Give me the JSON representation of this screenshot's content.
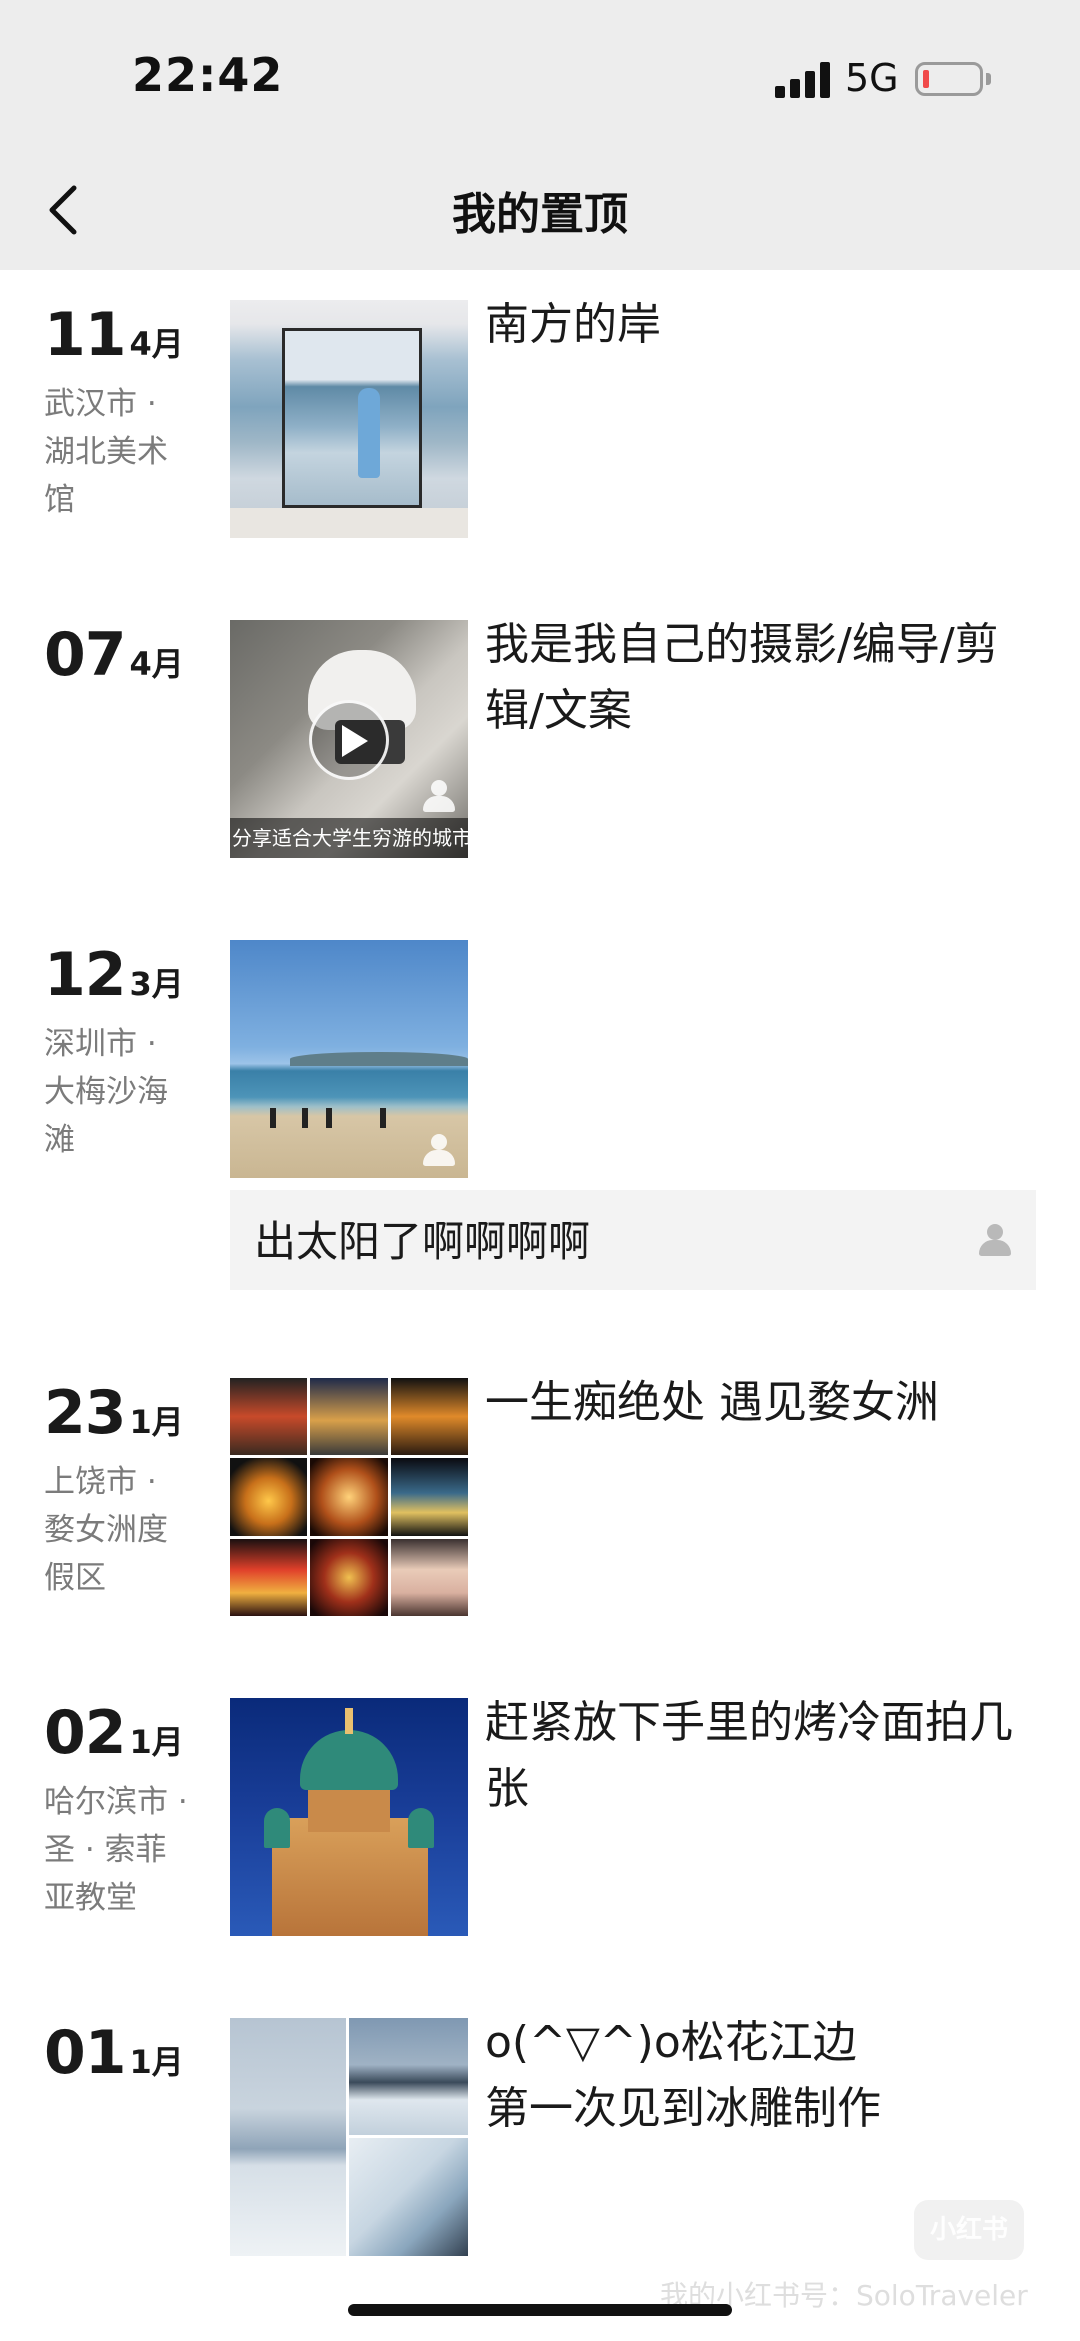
{
  "status_bar": {
    "time": "22:42",
    "network": "5G",
    "icons": [
      "signal-icon",
      "battery-icon"
    ],
    "battery_level": 0.1
  },
  "nav": {
    "title": "我的置顶",
    "back_icon": "chevron-left-icon"
  },
  "entries": [
    {
      "day": "11",
      "month": "4月",
      "location": "武汉市 · 湖北美术馆",
      "text": "南方的岸",
      "media": "photo"
    },
    {
      "day": "07",
      "month": "4月",
      "location": "",
      "text": "我是我自己的摄影/编导/剪辑/文案",
      "media": "video",
      "video_caption": "分享适合大学生穷游的城市"
    },
    {
      "day": "12",
      "month": "3月",
      "location": "深圳市 · 大梅沙海滩",
      "text": "",
      "media": "photo",
      "comment": "出太阳了啊啊啊啊"
    },
    {
      "day": "23",
      "month": "1月",
      "location": "上饶市 · 婺女洲度假区",
      "text": "一生痴绝处 遇见婺女洲",
      "media": "photo-grid"
    },
    {
      "day": "02",
      "month": "1月",
      "location": "哈尔滨市 · 圣 · 索菲亚教堂",
      "text": "赶紧放下手里的烤冷面拍几张",
      "media": "photo"
    },
    {
      "day": "01",
      "month": "1月",
      "location": "",
      "text": "o(^▽^)o松花江边\n第一次见到冰雕制作",
      "media": "photo-collage"
    }
  ],
  "watermark": {
    "logo": "小红书",
    "text": "我的小红书号：SoloTraveler"
  },
  "colors": {
    "header_bg": "#ededed",
    "page_bg": "#ffffff",
    "text_primary": "#1a1a1a",
    "text_secondary": "#7b7b7b",
    "comment_bg": "#f3f3f3",
    "battery_low": "#f04a4a"
  }
}
